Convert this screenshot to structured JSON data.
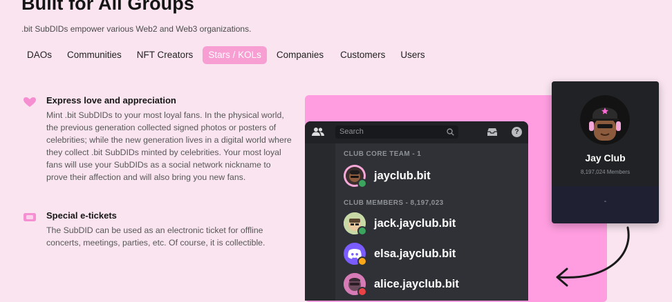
{
  "header": {
    "title": "Built for All Groups",
    "subtitle": ".bit SubDIDs empower various Web2 and Web3 organizations."
  },
  "tabs": [
    {
      "label": "DAOs",
      "active": false
    },
    {
      "label": "Communities",
      "active": false
    },
    {
      "label": "NFT Creators",
      "active": false
    },
    {
      "label": "Stars / KOLs",
      "active": true
    },
    {
      "label": "Companies",
      "active": false
    },
    {
      "label": "Customers",
      "active": false
    },
    {
      "label": "Users",
      "active": false
    }
  ],
  "features": [
    {
      "icon": "heart-icon",
      "title": "Express love and appreciation",
      "text": "Mint .bit SubDIDs to your most loyal fans. In the physical world, the previous generation collected signed photos or posters of celebrities; while the new generation lives in a digital world where they collect .bit SubDIDs minted by celebrities. Your most loyal fans will use your SubDIDs as a social network nickname to prove their affection and will also bring you new fans."
    },
    {
      "icon": "ticket-icon",
      "title": "Special e-tickets",
      "text": "The SubDID can be used as an electronic ticket for offline concerts, meetings, parties, etc. Of course, it is collectible."
    }
  ],
  "discord": {
    "search_placeholder": "Search",
    "help_glyph": "?",
    "core_team_label": "CLUB CORE TEAM - 1",
    "members_label": "CLUB MEMBERS - 8,197,023",
    "core_team": [
      {
        "name": "jayclub.bit",
        "status": "online"
      }
    ],
    "members": [
      {
        "name": "jack.jayclub.bit",
        "status": "online"
      },
      {
        "name": "elsa.jayclub.bit",
        "status": "idle"
      },
      {
        "name": "alice.jayclub.bit",
        "status": "dnd"
      }
    ],
    "colors": {
      "online": "#3ba55d",
      "idle": "#faa81a",
      "dnd": "#ed4245",
      "discord_blurple": "#7b5cff"
    }
  },
  "jay_card": {
    "name": "Jay Club",
    "members": "8,197,024 Members",
    "footer": "-"
  },
  "colors": {
    "page_bg": "#f9e4ef",
    "accent_pink": "#f79ed2",
    "panel_pink": "#ff9de0",
    "discord_bg": "#2f3136"
  }
}
